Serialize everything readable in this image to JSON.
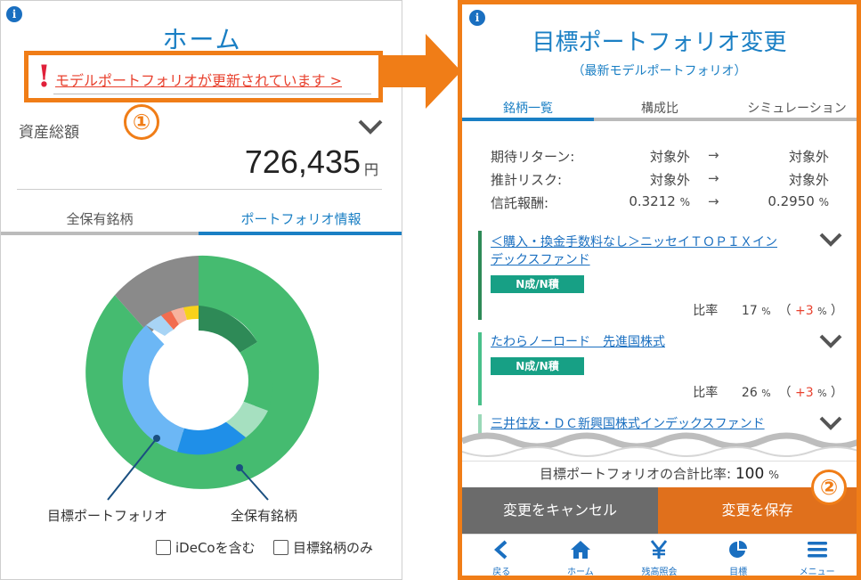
{
  "left": {
    "title": "ホーム",
    "alert_mark": "!",
    "alert_link": "モデルポートフォリオが更新されています >",
    "step_marker": "①",
    "asset_label": "資産総額",
    "asset_value": "726,435",
    "asset_unit": "円",
    "tabs": [
      {
        "label": "全保有銘柄",
        "active": false
      },
      {
        "label": "ポートフォリオ情報",
        "active": true
      }
    ],
    "legend": {
      "inner": "目標ポートフォリオ",
      "outer": "全保有銘柄"
    },
    "checkboxes": [
      {
        "label": "iDeCoを含む",
        "checked": false
      },
      {
        "label": "目標銘柄のみ",
        "checked": false
      }
    ]
  },
  "right": {
    "title": "目標ポートフォリオ変更",
    "subtitle": "（最新モデルポートフォリオ）",
    "step_marker": "②",
    "tabs": [
      {
        "label": "銘柄一覧",
        "active": true
      },
      {
        "label": "構成比",
        "active": false
      },
      {
        "label": "シミュレーション",
        "active": false
      }
    ],
    "metrics": [
      {
        "label": "期待リターン:",
        "from": "対象外",
        "from_unit": "",
        "arrow": "→",
        "to": "対象外",
        "to_unit": ""
      },
      {
        "label": "推計リスク:",
        "from": "対象外",
        "from_unit": "",
        "arrow": "→",
        "to": "対象外",
        "to_unit": ""
      },
      {
        "label": "信託報酬:",
        "from": "0.3212",
        "from_unit": "%",
        "arrow": "→",
        "to": "0.2950",
        "to_unit": "%"
      }
    ],
    "funds": [
      {
        "name_line1": "＜購入・換金手数料なし＞ニッセイＴＯＰＩＸイン",
        "name_line2": "デックスファンド",
        "tag": "N成/N積",
        "ratio_label": "比率",
        "ratio": "17",
        "unit": "%",
        "change": "+3",
        "change_unit": "%",
        "stripe": "#2e8a57"
      },
      {
        "name_line1": "たわらノーロード　先進国株式",
        "name_line2": "",
        "tag": "N成/N積",
        "ratio_label": "比率",
        "ratio": "26",
        "unit": "%",
        "change": "+3",
        "change_unit": "%",
        "stripe": "#49c08a"
      },
      {
        "name_line1": "三井住友・ＤＣ新興国株式インデックスファンド",
        "name_line2": "",
        "tag": "",
        "ratio_label": "",
        "ratio": "",
        "unit": "",
        "change": "",
        "change_unit": "",
        "stripe": "#9ad8b8"
      }
    ],
    "total_label": "目標ポートフォリオの合計比率:",
    "total_value": "100",
    "total_unit": "%",
    "cancel_label": "変更をキャンセル",
    "save_label": "変更を保存",
    "nav": [
      {
        "label": "戻る",
        "icon": "back-icon"
      },
      {
        "label": "ホーム",
        "icon": "home-icon"
      },
      {
        "label": "残高照会",
        "icon": "yen-icon"
      },
      {
        "label": "目標",
        "icon": "pie-icon"
      },
      {
        "label": "メニュー",
        "icon": "menu-icon"
      }
    ]
  },
  "colors": {
    "brand_blue": "#1a7fc4",
    "highlight_orange": "#f07d17",
    "alert_red": "#e8412e",
    "save_orange": "#e0701c",
    "cancel_gray": "#6b6b6b",
    "tag_teal": "#17a085"
  }
}
